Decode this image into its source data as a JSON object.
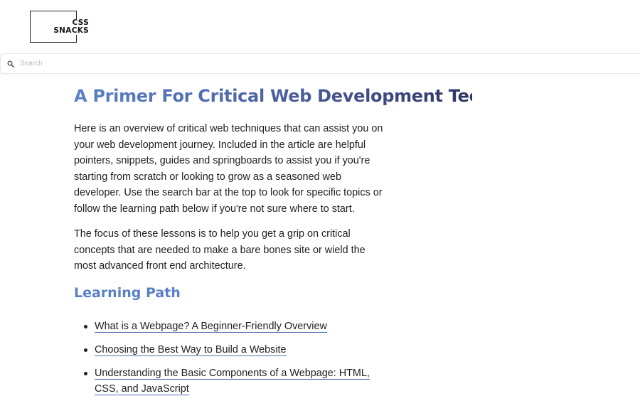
{
  "brand": {
    "logo_line1": "CSS",
    "logo_line2": "SNACKS"
  },
  "search": {
    "placeholder": "Search",
    "value": ""
  },
  "article": {
    "title": "A Primer For Critical Web Development Techniques",
    "paragraphs": [
      "Here is an overview of critical web techniques that can assist you on your web development journey. Included in the article are helpful pointers, snippets, guides and springboards to assist you if you're starting from scratch or looking to grow as a seasoned web developer. Use the search bar at the top to look for specific topics or follow the learning path below if you're not sure where to start.",
      "The focus of these lessons is to help you get a grip on critical concepts that are needed to make a bare bones site or wield the most advanced front end architecture."
    ],
    "learning_path": {
      "heading": "Learning Path",
      "items": [
        "What is a Webpage? A Beginner-Friendly Overview",
        "Choosing the Best Way to Build a Website",
        "Understanding the Basic Components of a Webpage: HTML, CSS, and JavaScript"
      ]
    }
  }
}
